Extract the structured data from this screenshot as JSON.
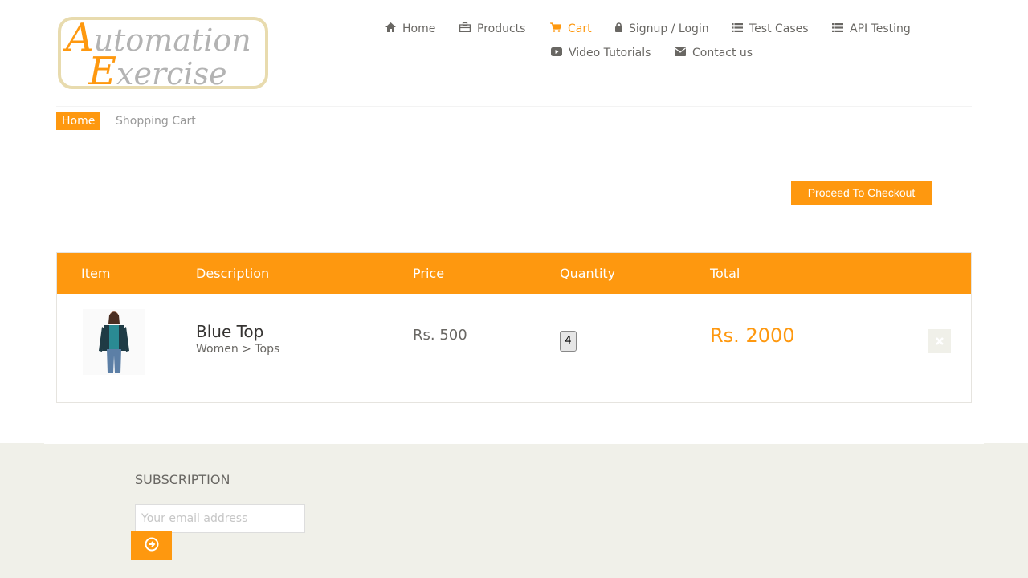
{
  "logo": {
    "line1_cap": "A",
    "line1_rest": "utomation",
    "line2_cap": "E",
    "line2_rest": "xercise"
  },
  "nav": {
    "items": [
      {
        "label": "Home",
        "icon": "home-icon"
      },
      {
        "label": "Products",
        "icon": "briefcase-icon"
      },
      {
        "label": "Cart",
        "icon": "cart-icon",
        "active": true
      },
      {
        "label": "Signup / Login",
        "icon": "lock-icon"
      },
      {
        "label": "Test Cases",
        "icon": "list-icon"
      },
      {
        "label": "API Testing",
        "icon": "list-icon"
      },
      {
        "label": "Video Tutorials",
        "icon": "youtube-play-icon"
      },
      {
        "label": "Contact us",
        "icon": "envelope-icon"
      }
    ]
  },
  "breadcrumb": {
    "home": "Home",
    "current": "Shopping Cart"
  },
  "checkout_button": "Proceed To Checkout",
  "cart": {
    "headers": [
      "Item",
      "Description",
      "Price",
      "Quantity",
      "Total"
    ],
    "rows": [
      {
        "name": "Blue Top",
        "category": "Women > Tops",
        "price": "Rs. 500",
        "quantity": "4",
        "total": "Rs. 2000",
        "delete_icon": "close-icon"
      }
    ]
  },
  "footer": {
    "subscription_title": "SUBSCRIPTION",
    "email_placeholder": "Your email address",
    "submit_icon": "arrow-circle-right-icon"
  },
  "colors": {
    "accent": "#fe980f",
    "text": "#696763",
    "footer_bg": "#f0f0e9"
  }
}
